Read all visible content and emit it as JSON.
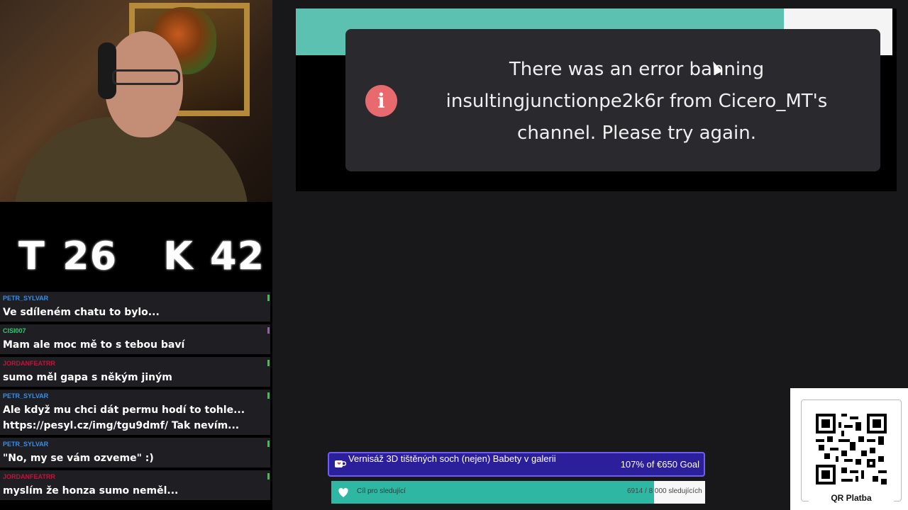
{
  "scoreboard": {
    "t_label": "T",
    "t_value": "26",
    "k_label": "K",
    "k_value": "42"
  },
  "chat": {
    "messages": [
      {
        "user": "PETR_SYLVAR",
        "text": "Ve sdíleném chatu to bylo...",
        "user_color": "#3a8ee6",
        "pip_color": "#2ecc40"
      },
      {
        "user": "CISI007",
        "text": "Mam ale moc mě to s tebou baví",
        "user_color": "#2ecc71",
        "pip_color": "#9b59b6"
      },
      {
        "user": "JORDANFEATRR",
        "text": "sumo měl gapa s někým jiným",
        "user_color": "#c0143c",
        "pip_color": "#2ecc40"
      },
      {
        "user": "PETR_SYLVAR",
        "text": "Ale když mu chci dát permu hodí to tohle...",
        "text2": "https://pesyl.cz/img/tgu9dmf/ Tak nevím...",
        "user_color": "#3a8ee6",
        "pip_color": "#2ecc40"
      },
      {
        "user": "PETR_SYLVAR",
        "text": "\"No, my se vám ozveme\" :)",
        "user_color": "#3a8ee6",
        "pip_color": "#2ecc40"
      },
      {
        "user": "JORDANFEATRR",
        "text": "myslím že honza sumo neměl...",
        "user_color": "#c0143c",
        "pip_color": "#2ecc40"
      }
    ]
  },
  "toast": {
    "message": "There was an error banning insultingjunctionpe2k6r from Cicero_MT's channel. Please try again.",
    "icon": "info-icon",
    "icon_color": "#e86a6f"
  },
  "goals": {
    "donation": {
      "title": "Vernisáž 3D tištěných soch (nejen) Babety v galerii",
      "progress_text": "107% of €650 Goal",
      "percent": 107,
      "bg_color": "#2c1f9c"
    },
    "followers": {
      "label": "Cíl pro sledující",
      "count_text": "6914 / 8 000 sledujících",
      "current": 6914,
      "target": 8000,
      "fill_color": "#2eb8a4"
    }
  },
  "qr": {
    "label": "QR Platba"
  }
}
